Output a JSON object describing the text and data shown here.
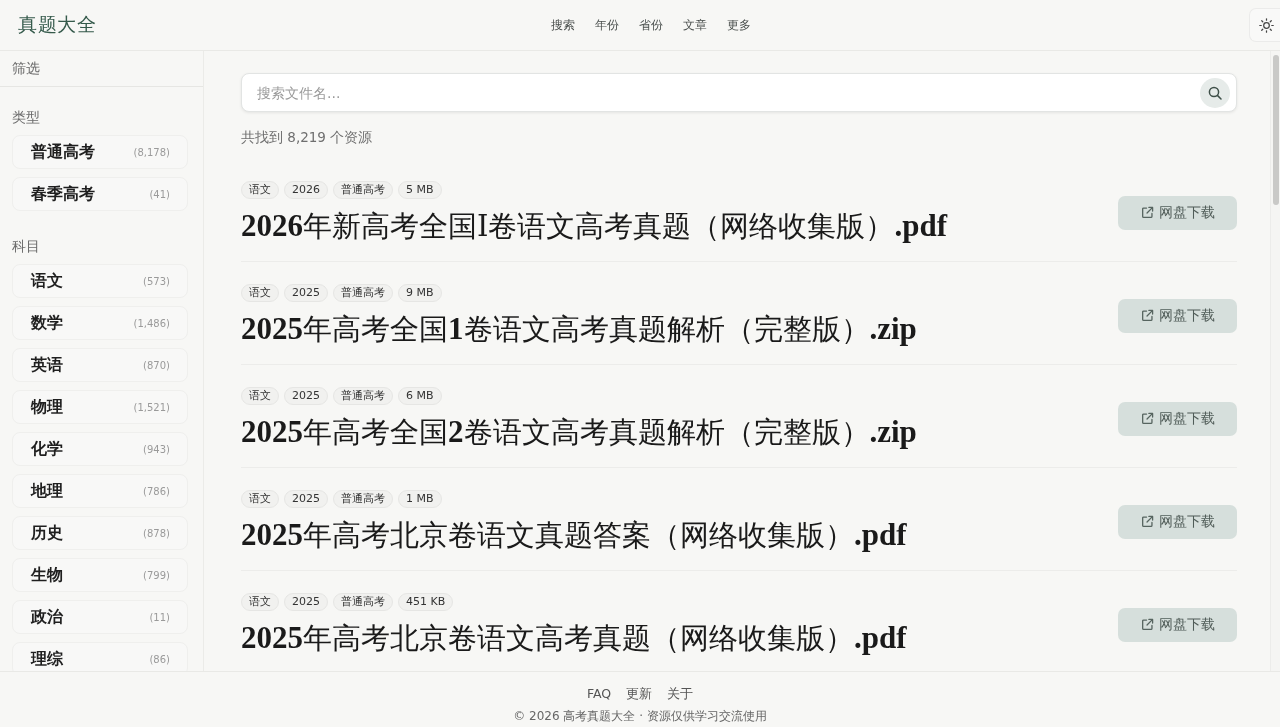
{
  "header": {
    "logo": "真题大全",
    "nav": [
      "搜索",
      "年份",
      "省份",
      "文章",
      "更多"
    ]
  },
  "sidebar": {
    "title": "筛选",
    "groups": [
      {
        "heading": "类型",
        "items": [
          {
            "label": "普通高考",
            "count": "(8,178)"
          },
          {
            "label": "春季高考",
            "count": "(41)"
          }
        ]
      },
      {
        "heading": "科目",
        "items": [
          {
            "label": "语文",
            "count": "(573)"
          },
          {
            "label": "数学",
            "count": "(1,486)"
          },
          {
            "label": "英语",
            "count": "(870)"
          },
          {
            "label": "物理",
            "count": "(1,521)"
          },
          {
            "label": "化学",
            "count": "(943)"
          },
          {
            "label": "地理",
            "count": "(786)"
          },
          {
            "label": "历史",
            "count": "(878)"
          },
          {
            "label": "生物",
            "count": "(799)"
          },
          {
            "label": "政治",
            "count": "(11)"
          },
          {
            "label": "理综",
            "count": "(86)"
          }
        ]
      }
    ]
  },
  "search": {
    "placeholder": "搜索文件名..."
  },
  "result_count": "共找到 8,219 个资源",
  "results": [
    {
      "tags": [
        "语文",
        "2026",
        "普通高考",
        "5 MB"
      ],
      "title": "**2026**年新高考全国Ⅰ卷语文高考真题（网络收集版）**.pdf**",
      "button": "网盘下载"
    },
    {
      "tags": [
        "语文",
        "2025",
        "普通高考",
        "9 MB"
      ],
      "title": "**2025**年高考全国**1**卷语文高考真题解析（完整版）**.zip**",
      "button": "网盘下载"
    },
    {
      "tags": [
        "语文",
        "2025",
        "普通高考",
        "6 MB"
      ],
      "title": "**2025**年高考全国**2**卷语文高考真题解析（完整版）**.zip**",
      "button": "网盘下载"
    },
    {
      "tags": [
        "语文",
        "2025",
        "普通高考",
        "1 MB"
      ],
      "title": "**2025**年高考北京卷语文真题答案（网络收集版）**.pdf**",
      "button": "网盘下载"
    },
    {
      "tags": [
        "语文",
        "2025",
        "普通高考",
        "451 KB"
      ],
      "title": "**2025**年高考北京卷语文高考真题（网络收集版）**.pdf**",
      "button": "网盘下载"
    }
  ],
  "footer": {
    "links": [
      "FAQ",
      "更新",
      "关于"
    ],
    "copyright": "© 2026 高考真题大全 · 资源仅供学习交流使用"
  }
}
